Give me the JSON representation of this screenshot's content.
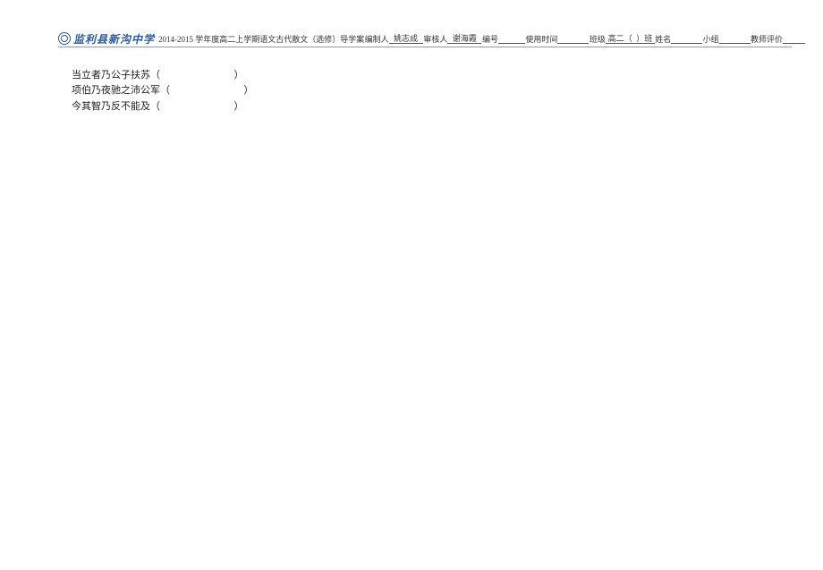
{
  "header": {
    "school_name": "监利县新沟中学",
    "course_info": "2014-2015 学年度高二上学期语文古代散文（选修）导学案",
    "fields": {
      "compiler_label": "编制人",
      "compiler_value": "姚志成",
      "reviewer_label": "审核人",
      "reviewer_value": "谢海霞",
      "number_label": "编号",
      "number_value": "",
      "usage_time_label": "使用时间",
      "usage_time_value": "",
      "class_label": "班级",
      "class_value_prefix": "高二（",
      "class_value_suffix": "）班",
      "name_label": "姓名",
      "name_value": "",
      "group_label": "小组",
      "group_value": "",
      "teacher_eval_label": "教师评价",
      "teacher_eval_value": ""
    }
  },
  "content": {
    "lines": [
      {
        "text": "当立者乃公子扶苏（",
        "spaces": "                              ",
        "close": "）"
      },
      {
        "text": "项伯乃夜驰之沛公军（",
        "spaces": "                              ",
        "close": "）"
      },
      {
        "text": "今其智乃反不能及（",
        "spaces": "                              ",
        "close": "）"
      }
    ]
  }
}
